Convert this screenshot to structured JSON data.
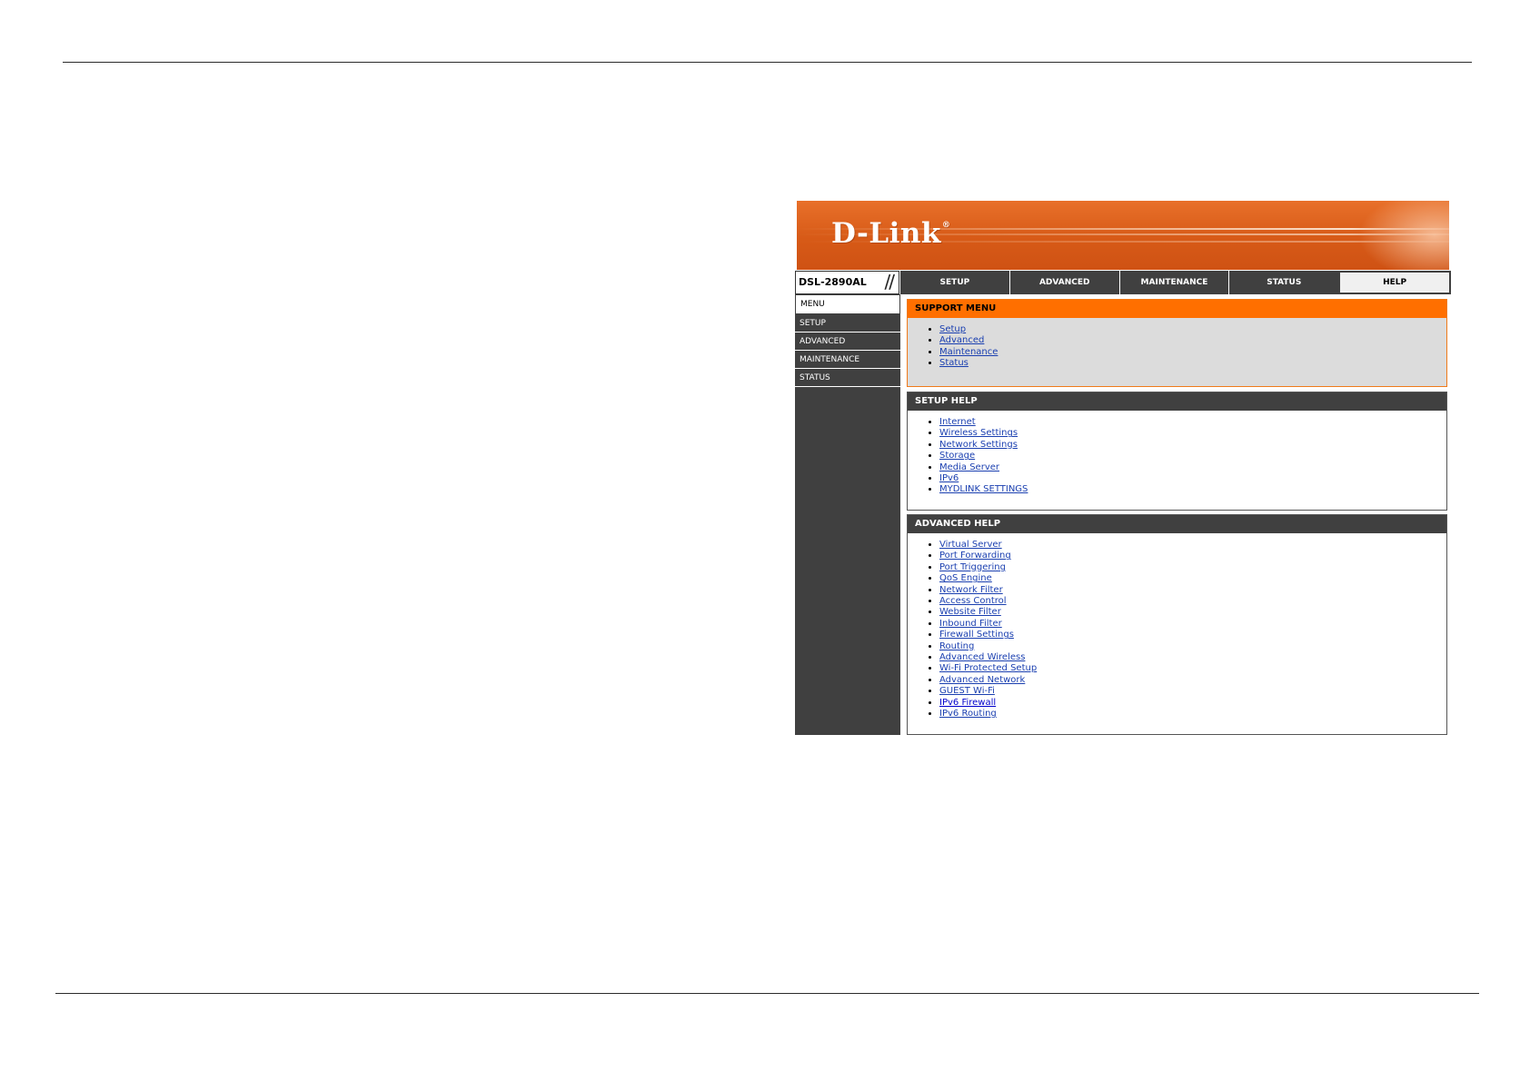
{
  "router_ui": {
    "brand": {
      "logo_text": "D-Link",
      "logo_mark": "®"
    },
    "model": "DSL-2890AL",
    "top_tabs": [
      {
        "label": "SETUP",
        "active": false
      },
      {
        "label": "ADVANCED",
        "active": false
      },
      {
        "label": "MAINTENANCE",
        "active": false
      },
      {
        "label": "STATUS",
        "active": false
      },
      {
        "label": "HELP",
        "active": true
      }
    ],
    "sidebar": {
      "items": [
        "MENU",
        "SETUP",
        "ADVANCED",
        "MAINTENANCE",
        "STATUS"
      ]
    },
    "support_menu": {
      "title": "SUPPORT MENU",
      "links": [
        "Setup",
        "Advanced",
        "Maintenance",
        "Status"
      ]
    },
    "setup_help": {
      "title": "SETUP HELP",
      "links": [
        "Internet",
        "Wireless Settings",
        "Network Settings",
        "Storage",
        "Media Server",
        "IPv6",
        "MYDLINK SETTINGS"
      ]
    },
    "advanced_help": {
      "title": "ADVANCED HELP",
      "links": [
        "Virtual Server",
        "Port Forwarding",
        "Port Triggering",
        "QoS Engine",
        "Network Filter",
        "Access Control",
        "Website Filter",
        "Inbound Filter",
        "Firewall Settings",
        "Routing",
        "Advanced Wireless",
        "Wi-Fi Protected Setup",
        "Advanced Network",
        "GUEST Wi-Fi",
        "IPv6 Firewall",
        "IPv6 Routing"
      ]
    },
    "colors": {
      "banner_orange": "#d75a17",
      "support_header": "#ff6f00",
      "nav_dark": "#404040",
      "link_blue": "#1a3fb0"
    }
  }
}
